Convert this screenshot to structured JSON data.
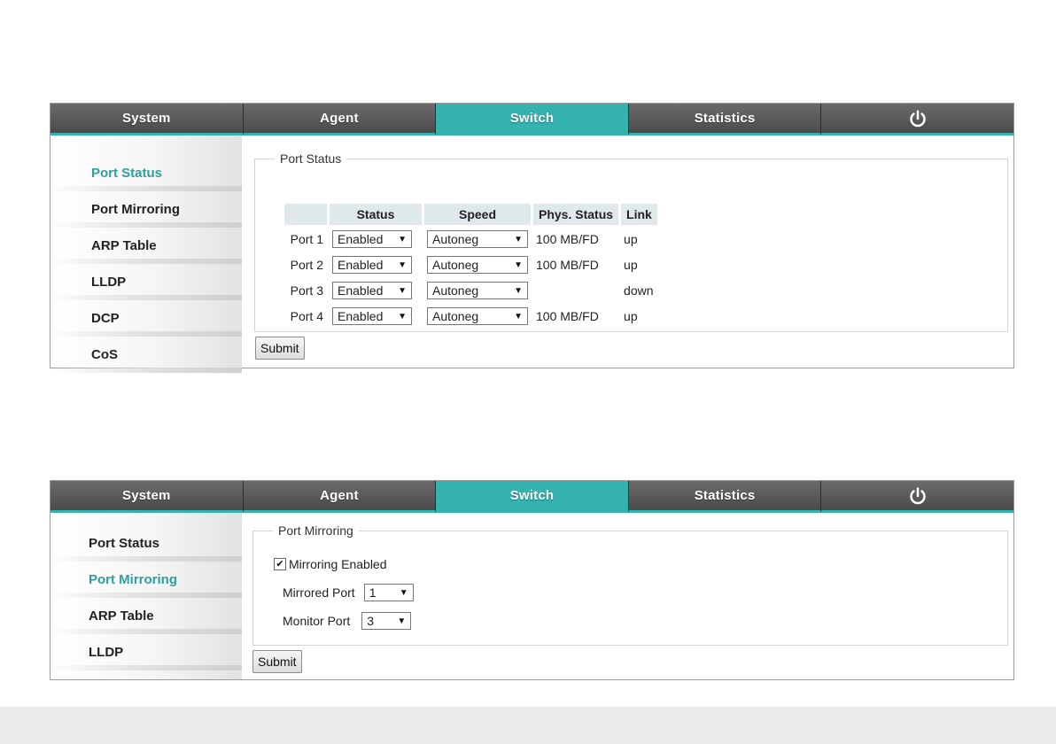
{
  "nav": {
    "tabs": [
      "System",
      "Agent",
      "Switch",
      "Statistics"
    ],
    "active_tab": "Switch",
    "power_icon": "power-icon"
  },
  "panel1": {
    "sidebar": [
      "Port Status",
      "Port Mirroring",
      "ARP Table",
      "LLDP",
      "DCP",
      "CoS"
    ],
    "active": "Port Status",
    "legend": "Port Status",
    "headers": {
      "status": "Status",
      "speed": "Speed",
      "phys": "Phys. Status",
      "link": "Link"
    },
    "ports": [
      {
        "label": "Port 1",
        "status": "Enabled",
        "speed": "Autoneg",
        "phys": "100 MB/FD",
        "link": "up"
      },
      {
        "label": "Port 2",
        "status": "Enabled",
        "speed": "Autoneg",
        "phys": "100 MB/FD",
        "link": "up"
      },
      {
        "label": "Port 3",
        "status": "Enabled",
        "speed": "Autoneg",
        "phys": "",
        "link": "down"
      },
      {
        "label": "Port 4",
        "status": "Enabled",
        "speed": "Autoneg",
        "phys": "100 MB/FD",
        "link": "up"
      }
    ],
    "submit": "Submit"
  },
  "panel2": {
    "sidebar": [
      "Port Status",
      "Port Mirroring",
      "ARP Table",
      "LLDP"
    ],
    "active": "Port Mirroring",
    "legend": "Port Mirroring",
    "mirroring_enabled_label": "Mirroring Enabled",
    "mirroring_enabled": true,
    "mirrored_port_label": "Mirrored Port",
    "mirrored_port_value": "1",
    "monitor_port_label": "Monitor Port",
    "monitor_port_value": "3",
    "submit": "Submit"
  },
  "colors": {
    "accent": "#34b2b0",
    "tab_dark": "#555555",
    "active_text": "#2f9e9c"
  }
}
